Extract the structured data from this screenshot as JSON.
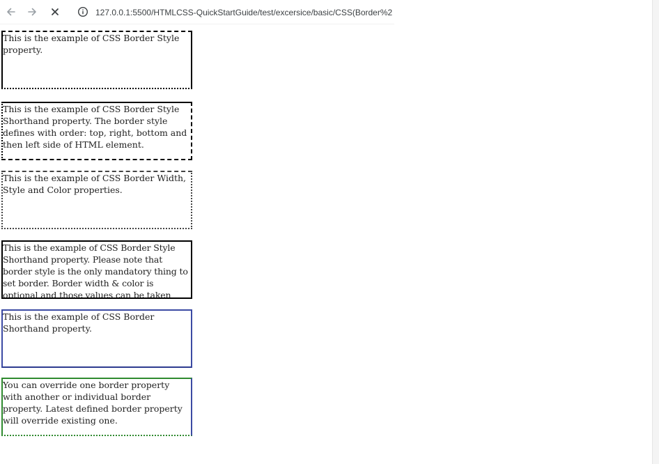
{
  "browser": {
    "url": "127.0.0.1:5500/HTMLCSS-QuickStartGuide/test/excersice/basic/CSS(Border%2",
    "icons": {
      "back": "arrow-left-icon",
      "forward": "arrow-right-icon",
      "stop": "close-icon",
      "info": "info-circle-icon"
    }
  },
  "boxes": [
    {
      "text": "This is the example of CSS Border Style property."
    },
    {
      "text": "This is the example of CSS Border Style Shorthand property. The border style defines with order: top, right, bottom and then left side of HTML element."
    },
    {
      "text": "This is the example of CSS Border Width, Style and Color properties."
    },
    {
      "text": "This is the example of CSS Border Style Shorthand property. Please note that border style is the only mandatory thing to set border. Border width & color is optional and those values can be taken from browsers default."
    },
    {
      "text": "This is the example of CSS Border Shorthand property."
    },
    {
      "text": "You can override one border property with another or individual border property. Latest defined border property will override existing one."
    }
  ],
  "colors": {
    "box5_border": "#3b4aa3",
    "box6_border": "#2f8a2f"
  }
}
